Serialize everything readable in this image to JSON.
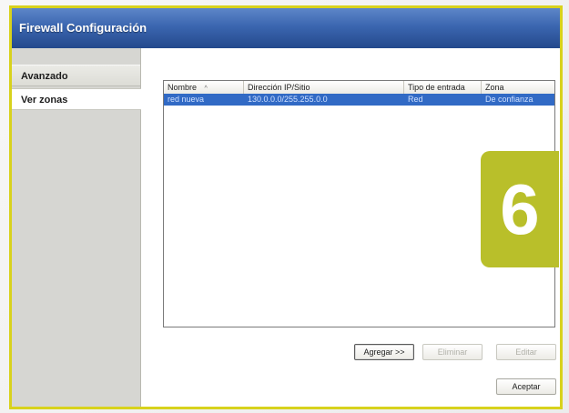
{
  "window": {
    "title": "Firewall Configuración"
  },
  "sidebar": {
    "items": [
      {
        "label": "Avanzado"
      },
      {
        "label": "Ver zonas"
      }
    ]
  },
  "table": {
    "columns": [
      "Nombre",
      "Dirección IP/Sitio",
      "Tipo de entrada",
      "Zona"
    ],
    "sort_indicator": "^",
    "rows": [
      {
        "name": "red nueva",
        "address": "130.0.0.0/255.255.0.0",
        "type": "Red",
        "zone": "De confianza"
      }
    ]
  },
  "buttons": {
    "add": "Agregar >>",
    "remove": "Eliminar",
    "edit": "Editar",
    "accept": "Aceptar"
  },
  "step_badge": "6",
  "colors": {
    "accent_border": "#d8d21c",
    "badge": "#b9bf2a",
    "selection": "#316ac5",
    "titlebar": "#3b66b0"
  }
}
